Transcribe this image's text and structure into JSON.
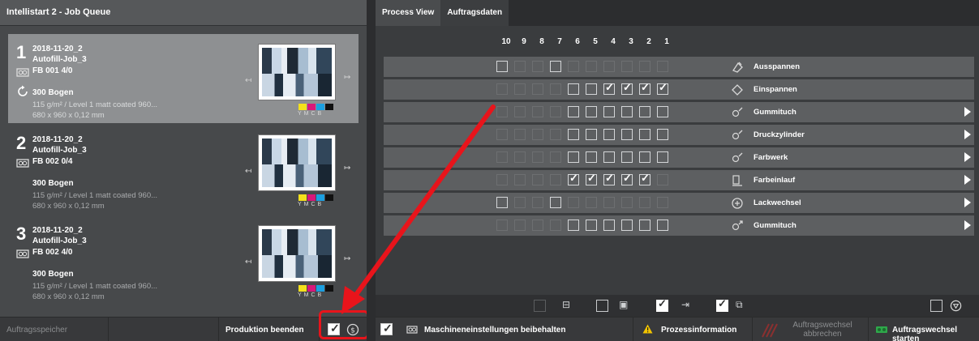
{
  "left_panel": {
    "title": "Intellistart 2 - Job Queue",
    "jobs": [
      {
        "num": "1",
        "date": "2018-11-20_2",
        "name": "Autofill-Job_3",
        "fb": "FB 001  4/0",
        "bogen": "300 Bogen",
        "paper": "115 g/m² / Level 1 matt coated 960...",
        "size": "680 x 960 x 0,12 mm",
        "selected": true
      },
      {
        "num": "2",
        "date": "2018-11-20_2",
        "name": "Autofill-Job_3",
        "fb": "FB 002  0/4",
        "bogen": "300 Bogen",
        "paper": "115 g/m² / Level 1 matt coated 960...",
        "size": "680 x 960 x 0,12 mm",
        "selected": false
      },
      {
        "num": "3",
        "date": "2018-11-20_2",
        "name": "Autofill-Job_3",
        "fb": "FB 002  4/0",
        "bogen": "300 Bogen",
        "paper": "115 g/m² / Level 1 matt coated 960...",
        "size": "680 x 960 x 0,12 mm",
        "selected": false
      }
    ],
    "cmyk_labels": "YMCB",
    "cmyk_colors": [
      "#f4e01c",
      "#d8187a",
      "#1c9fe0",
      "#111111"
    ],
    "bottom": {
      "speicher": "Auftragsspeicher",
      "beenden": "Produktion beenden"
    }
  },
  "right_panel": {
    "tabs": [
      "Process View",
      "Auftragsdaten"
    ],
    "columns": [
      "10",
      "9",
      "8",
      "7",
      "6",
      "5",
      "4",
      "3",
      "2",
      "1"
    ],
    "rows": [
      {
        "label": "Ausspannen",
        "icon": "unclamp-icon",
        "cells": [
          "box",
          "ghost",
          "ghost",
          "box",
          "ghost",
          "ghost",
          "ghost",
          "ghost",
          "ghost",
          "ghost"
        ],
        "arrow": false
      },
      {
        "label": "Einspannen",
        "icon": "clamp-icon",
        "cells": [
          "ghost",
          "ghost",
          "ghost",
          "ghost",
          "box",
          "box",
          "chk",
          "chk",
          "chk",
          "chk"
        ],
        "arrow": false
      },
      {
        "label": "Gummituch",
        "icon": "blanket-wash-icon",
        "cells": [
          "ghost",
          "ghost",
          "ghost",
          "ghost",
          "box",
          "box",
          "box",
          "box",
          "box",
          "box"
        ],
        "arrow": true
      },
      {
        "label": "Druckzylinder",
        "icon": "cylinder-wash-icon",
        "cells": [
          "ghost",
          "ghost",
          "ghost",
          "ghost",
          "box",
          "box",
          "box",
          "box",
          "box",
          "box"
        ],
        "arrow": true
      },
      {
        "label": "Farbwerk",
        "icon": "inking-wash-icon",
        "cells": [
          "ghost",
          "ghost",
          "ghost",
          "ghost",
          "box",
          "box",
          "box",
          "box",
          "box",
          "box"
        ],
        "arrow": true
      },
      {
        "label": "Farbeinlauf",
        "icon": "ink-run-in-icon",
        "cells": [
          "ghost",
          "ghost",
          "ghost",
          "ghost",
          "chk",
          "chk",
          "chk",
          "chk",
          "chk",
          "ghost"
        ],
        "arrow": true
      },
      {
        "label": "Lackwechsel",
        "icon": "coating-change-icon",
        "cells": [
          "box",
          "ghost",
          "ghost",
          "box",
          "ghost",
          "ghost",
          "ghost",
          "ghost",
          "ghost",
          "ghost"
        ],
        "arrow": true
      },
      {
        "label": "Gummituch",
        "icon": "blanket-change-icon",
        "cells": [
          "ghost",
          "ghost",
          "ghost",
          "ghost",
          "box",
          "box",
          "box",
          "box",
          "box",
          "box"
        ],
        "arrow": true
      }
    ],
    "bottom": {
      "keep": "Maschineneinstellungen beibehalten",
      "info": "Prozessinformation",
      "abort_line1": "Auftragswechsel",
      "abort_line2": "abbrechen",
      "start": "Auftragswechsel starten"
    }
  },
  "colors": {
    "annotation_red": "#e8141b",
    "warning_yellow": "#f2c400",
    "start_green": "#2ea84a"
  }
}
